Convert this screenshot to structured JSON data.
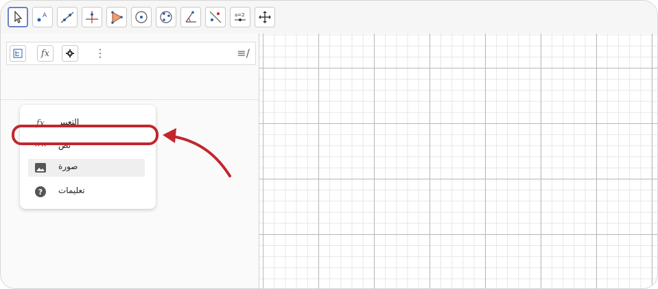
{
  "toolbar": {
    "tools": [
      {
        "name": "move-tool-icon"
      },
      {
        "name": "point-tool-icon"
      },
      {
        "name": "line-tool-icon"
      },
      {
        "name": "perpendicular-line-icon"
      },
      {
        "name": "polygon-tool-icon"
      },
      {
        "name": "circle-center-point-icon"
      },
      {
        "name": "circle-three-points-icon"
      },
      {
        "name": "angle-tool-icon"
      },
      {
        "name": "reflect-line-icon"
      },
      {
        "name": "slider-tool-icon",
        "text": "a=2"
      },
      {
        "name": "move-graphics-view-icon"
      }
    ]
  },
  "algebra": {
    "header": {
      "kebab": "⋮",
      "sort_icon": "≡∕"
    },
    "menu": {
      "items": [
        {
          "label": "التعبير",
          "icon": "function-icon"
        },
        {
          "label": "نص",
          "icon": "quote-icon"
        },
        {
          "label": "صورة",
          "icon": "image-icon",
          "selected": true
        },
        {
          "label": "تعليمات",
          "icon": "help-icon"
        }
      ]
    }
  },
  "colors": {
    "highlight": "#c1272d",
    "active_border": "#6b7fc9"
  }
}
